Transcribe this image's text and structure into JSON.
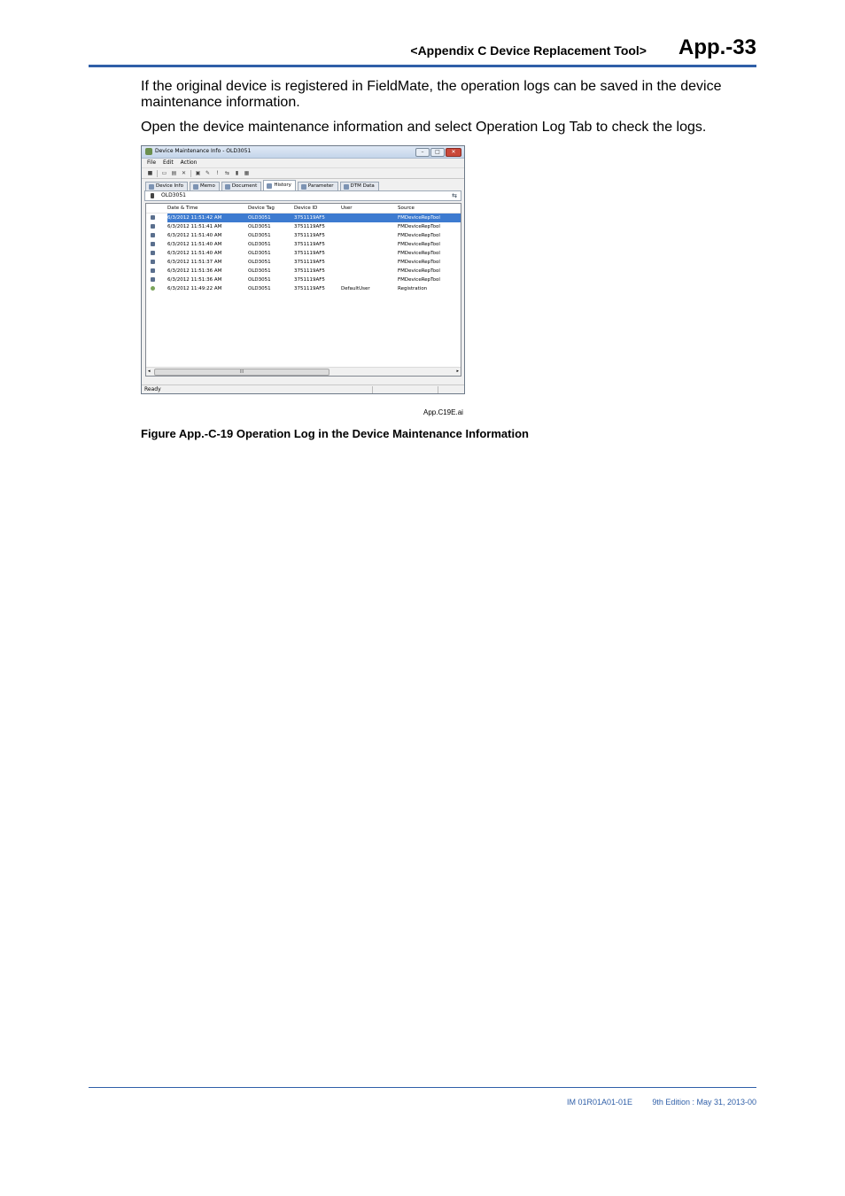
{
  "header": {
    "section": "<Appendix C  Device Replacement Tool>",
    "page": "App.-33"
  },
  "body": {
    "paragraph1": "If the original device is registered in FieldMate, the operation logs can be saved in the device maintenance information.",
    "paragraph2": "Open the device maintenance information and select Operation Log Tab to check the logs."
  },
  "window": {
    "title": "Device Maintenance Info - OLD3051",
    "menu": [
      "File",
      "Edit",
      "Action"
    ],
    "tabs": [
      "Device Info",
      "Memo",
      "Document",
      "History",
      "Parameter",
      "DTM Data"
    ],
    "active_tab": "History",
    "device_name": "OLD3051",
    "columns": [
      "Date & Time",
      "Device Tag",
      "Device ID",
      "User",
      "Source"
    ],
    "rows": [
      [
        "6/3/2012 11:51:42 AM",
        "OLD3051",
        "3751119AF5",
        "",
        "FMDeviceRepTool"
      ],
      [
        "6/3/2012 11:51:41 AM",
        "OLD3051",
        "3751119AF5",
        "",
        "FMDeviceRepTool"
      ],
      [
        "6/3/2012 11:51:40 AM",
        "OLD3051",
        "3751119AF5",
        "",
        "FMDeviceRepTool"
      ],
      [
        "6/3/2012 11:51:40 AM",
        "OLD3051",
        "3751119AF5",
        "",
        "FMDeviceRepTool"
      ],
      [
        "6/3/2012 11:51:40 AM",
        "OLD3051",
        "3751119AF5",
        "",
        "FMDeviceRepTool"
      ],
      [
        "6/3/2012 11:51:37 AM",
        "OLD3051",
        "3751119AF5",
        "",
        "FMDeviceRepTool"
      ],
      [
        "6/3/2012 11:51:36 AM",
        "OLD3051",
        "3751119AF5",
        "",
        "FMDeviceRepTool"
      ],
      [
        "6/3/2012 11:51:36 AM",
        "OLD3051",
        "3751119AF5",
        "",
        "FMDeviceRepTool"
      ],
      [
        "6/3/2012 11:49:22 AM",
        "OLD3051",
        "3751119AF5",
        "DefaultUser",
        "Registration"
      ]
    ],
    "scroll_thumb_label": "III",
    "status": "Ready"
  },
  "figure": {
    "file": "App.C19E.ai",
    "caption": "Figure App.-C-19  Operation Log in the Device Maintenance Information"
  },
  "footer": {
    "doc": "IM 01R01A01-01E",
    "edition": "9th Edition : May 31, 2013-00"
  }
}
